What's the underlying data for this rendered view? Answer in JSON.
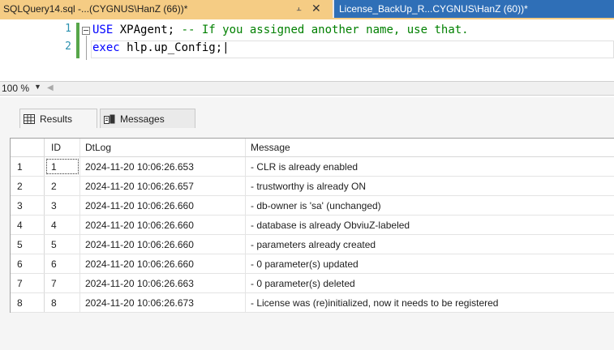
{
  "tabs": {
    "active_label": "SQLQuery14.sql -...(CYGNUS\\HanZ (66))*",
    "inactive_label": "License_BackUp_R...CYGNUS\\HanZ (60))*"
  },
  "editor": {
    "lines": [
      {
        "num": "1",
        "kw": "USE",
        "rest": " XPAgent; ",
        "comment": "-- If you assigned another name, use that."
      },
      {
        "num": "2",
        "kw": "exec",
        "rest": " hlp.up_Config;",
        "comment": ""
      }
    ]
  },
  "zoom": {
    "value": "100 %"
  },
  "result_tabs": {
    "results_label": "Results",
    "messages_label": "Messages"
  },
  "grid": {
    "headers": [
      "",
      "ID",
      "DtLog",
      "Message"
    ],
    "rows": [
      [
        "1",
        "1",
        "2024-11-20 10:06:26.653",
        "- CLR is already enabled"
      ],
      [
        "2",
        "2",
        "2024-11-20 10:06:26.657",
        "- trustworthy is already ON"
      ],
      [
        "3",
        "3",
        "2024-11-20 10:06:26.660",
        "- db-owner is 'sa' (unchanged)"
      ],
      [
        "4",
        "4",
        "2024-11-20 10:06:26.660",
        "- database is already ObviuZ-labeled"
      ],
      [
        "5",
        "5",
        "2024-11-20 10:06:26.660",
        "- parameters already created"
      ],
      [
        "6",
        "6",
        "2024-11-20 10:06:26.660",
        "- 0 parameter(s) updated"
      ],
      [
        "7",
        "7",
        "2024-11-20 10:06:26.663",
        "- 0 parameter(s) deleted"
      ],
      [
        "8",
        "8",
        "2024-11-20 10:06:26.673",
        "- License was (re)initialized, now it needs to be registered"
      ]
    ]
  },
  "colors": {
    "active_tab": "#f5cc84",
    "inactive_tab": "#2f6fb7",
    "keyword": "#0000ff",
    "comment": "#008000",
    "line_number": "#2b91af"
  }
}
